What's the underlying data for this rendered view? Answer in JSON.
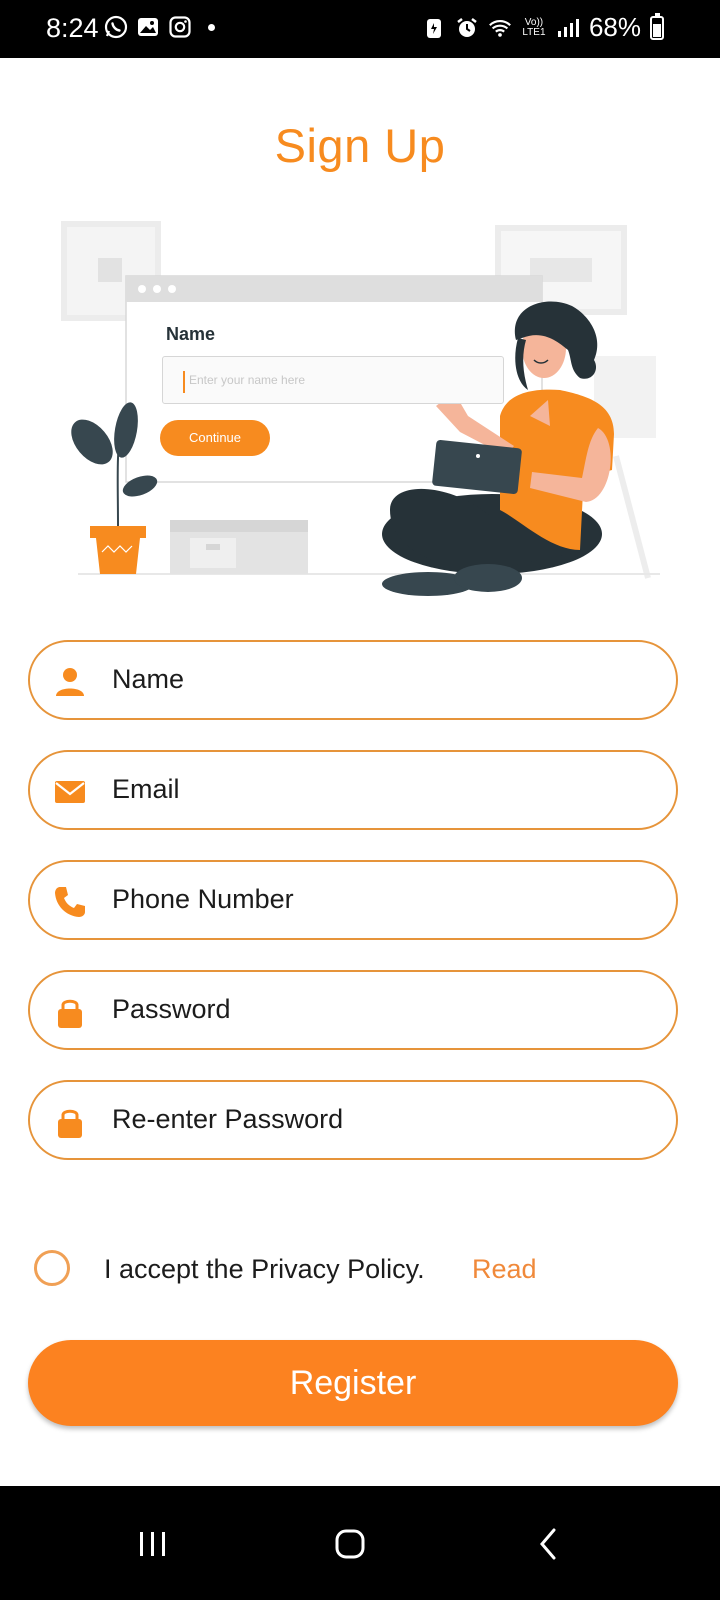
{
  "status_bar": {
    "time": "8:24",
    "left_icons": [
      "whatsapp-icon",
      "gallery-icon",
      "instagram-icon"
    ],
    "right_icons": [
      "battery-saver-icon",
      "alarm-icon",
      "wifi-icon",
      "volte-icon",
      "signal-icon"
    ],
    "volte_label": "Vo)) LTE1",
    "battery": "68%",
    "battery_level": 0.68
  },
  "title": "Sign Up",
  "illustration": {
    "name_label": "Name",
    "input_placeholder": "Enter your name here",
    "continue_label": "Continue"
  },
  "form": {
    "fields": [
      {
        "label": "Name",
        "icon": "person-icon"
      },
      {
        "label": "Email",
        "icon": "email-icon"
      },
      {
        "label": "Phone Number",
        "icon": "phone-icon"
      },
      {
        "label": "Password",
        "icon": "lock-icon"
      },
      {
        "label": "Re-enter Password",
        "icon": "lock-icon"
      }
    ],
    "privacy_text": "I accept the Privacy Policy.",
    "privacy_link": "Read",
    "privacy_checked": false,
    "register_label": "Register"
  },
  "nav_bar": {
    "buttons": [
      "recents-icon",
      "home-icon",
      "back-icon"
    ]
  },
  "colors": {
    "accent": "#f78b1f",
    "field_border": "#e6943a",
    "button": "#fc8220",
    "status_bar": "#000000"
  }
}
